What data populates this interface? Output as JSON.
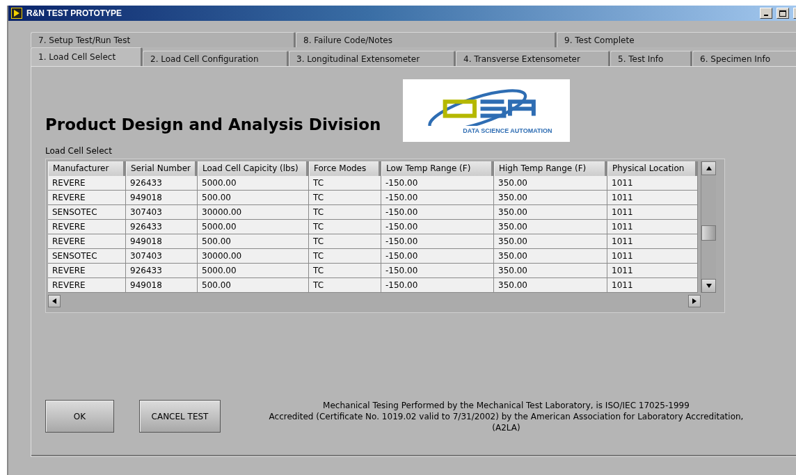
{
  "window": {
    "title": "R&N TEST PROTOTYPE"
  },
  "tab_rows": [
    [
      {
        "label": "7. Setup Test/Run Test",
        "selected": false
      },
      {
        "label": "8. Failure Code/Notes",
        "selected": false
      },
      {
        "label": "9. Test Complete",
        "selected": false
      }
    ],
    [
      {
        "label": "1. Load Cell Select",
        "selected": true
      },
      {
        "label": "2. Load Cell Configuration",
        "selected": false
      },
      {
        "label": "3. Longitudinal  Extensometer",
        "selected": false
      },
      {
        "label": "4. Transverse Extensometer",
        "selected": false
      },
      {
        "label": "5. Test Info",
        "selected": false
      },
      {
        "label": "6. Specimen Info",
        "selected": false
      }
    ]
  ],
  "heading": "Product Design and Analysis Division",
  "logo": {
    "caption": "DATA SCIENCE AUTOMATION"
  },
  "table": {
    "label": "Load Cell Select",
    "columns": [
      "Manufacturer",
      "Serial Number",
      "Load Cell Capicity (lbs)",
      "Force Modes",
      "Low Temp Range (F)",
      "High Temp Range (F)",
      "Physical Location"
    ],
    "rows": [
      [
        "REVERE",
        "926433",
        "5000.00",
        "TC",
        "-150.00",
        "350.00",
        "1011"
      ],
      [
        "REVERE",
        "949018",
        "500.00",
        "TC",
        "-150.00",
        "350.00",
        "1011"
      ],
      [
        "SENSOTEC",
        "307403",
        "30000.00",
        "TC",
        "-150.00",
        "350.00",
        "1011"
      ],
      [
        "REVERE",
        "926433",
        "5000.00",
        "TC",
        "-150.00",
        "350.00",
        "1011"
      ],
      [
        "REVERE",
        "949018",
        "500.00",
        "TC",
        "-150.00",
        "350.00",
        "1011"
      ],
      [
        "SENSOTEC",
        "307403",
        "30000.00",
        "TC",
        "-150.00",
        "350.00",
        "1011"
      ],
      [
        "REVERE",
        "926433",
        "5000.00",
        "TC",
        "-150.00",
        "350.00",
        "1011"
      ],
      [
        "REVERE",
        "949018",
        "500.00",
        "TC",
        "-150.00",
        "350.00",
        "1011"
      ]
    ]
  },
  "buttons": [
    "OK",
    "CANCEL TEST"
  ],
  "footer": [
    "Mechanical Tesing Performed by the Mechanical Test Laboratory, is ISO/IEC 17025-1999",
    "Accredited (Certificate No. 1019.02 valid to 7/31/2002) by the American Association for Laboratory Accreditation,",
    "(A2LA)"
  ]
}
